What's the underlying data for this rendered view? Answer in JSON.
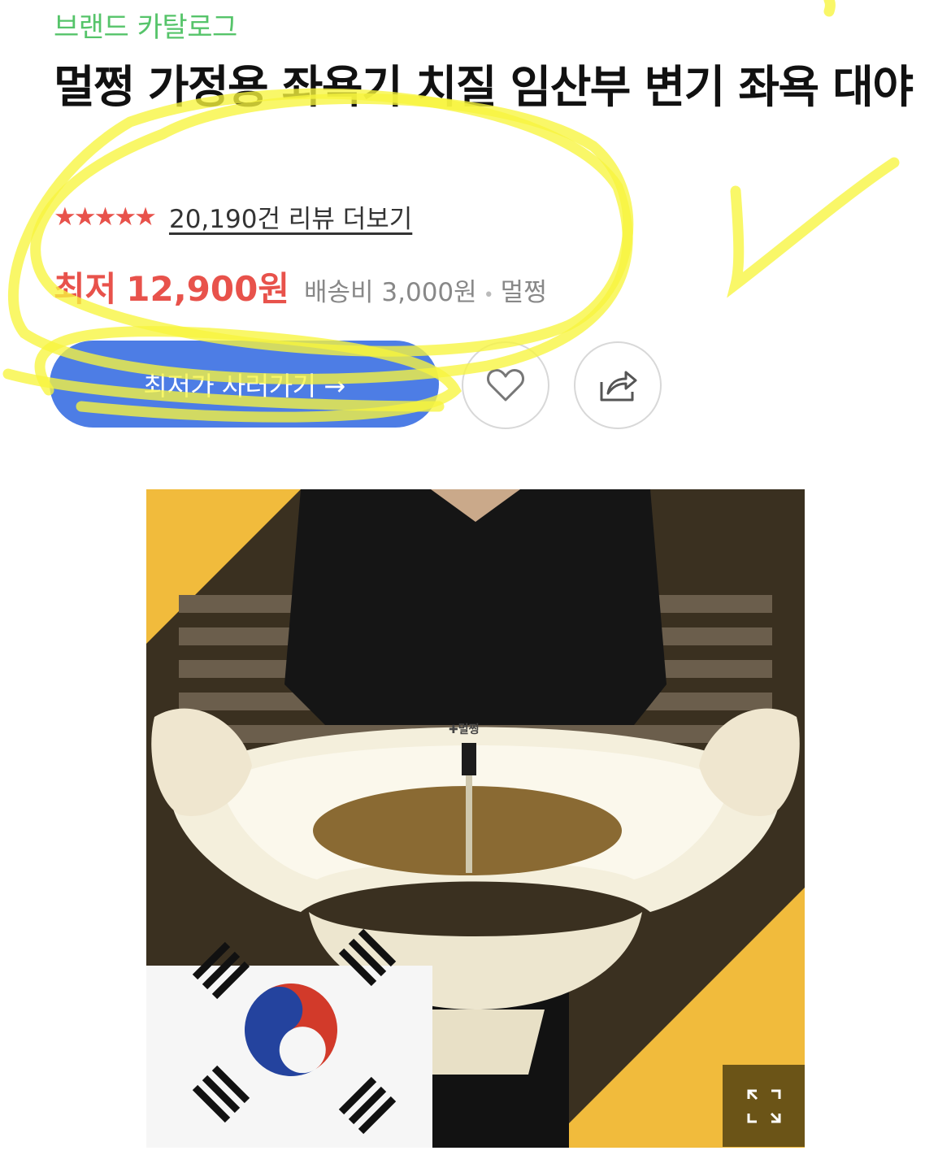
{
  "brand": {
    "label": "브랜드 카탈로그",
    "color": "#56c46a"
  },
  "product": {
    "title": "멀쩡 가정용 좌욕기 치질 임산부 변기 좌욕 대야",
    "rating_stars": "★★★★★",
    "rating_value": 5,
    "review_link": "20,190건 리뷰 더보기",
    "price_label": "최저",
    "price_value": "12,900원",
    "shipping": "배송비 3,000원",
    "separator": "•",
    "seller": "멀쩡"
  },
  "actions": {
    "buy_label": "최저가 사러가기 →",
    "like_icon": "heart-icon",
    "share_icon": "share-icon"
  },
  "image": {
    "logo_text": "✚멀쩡",
    "expand_icon": "expand-icon"
  },
  "colors": {
    "accent_price": "#e8524b",
    "buy_button": "#4d7de5",
    "image_background": "#f1bb3c",
    "highlighter": "#f7f53e"
  }
}
